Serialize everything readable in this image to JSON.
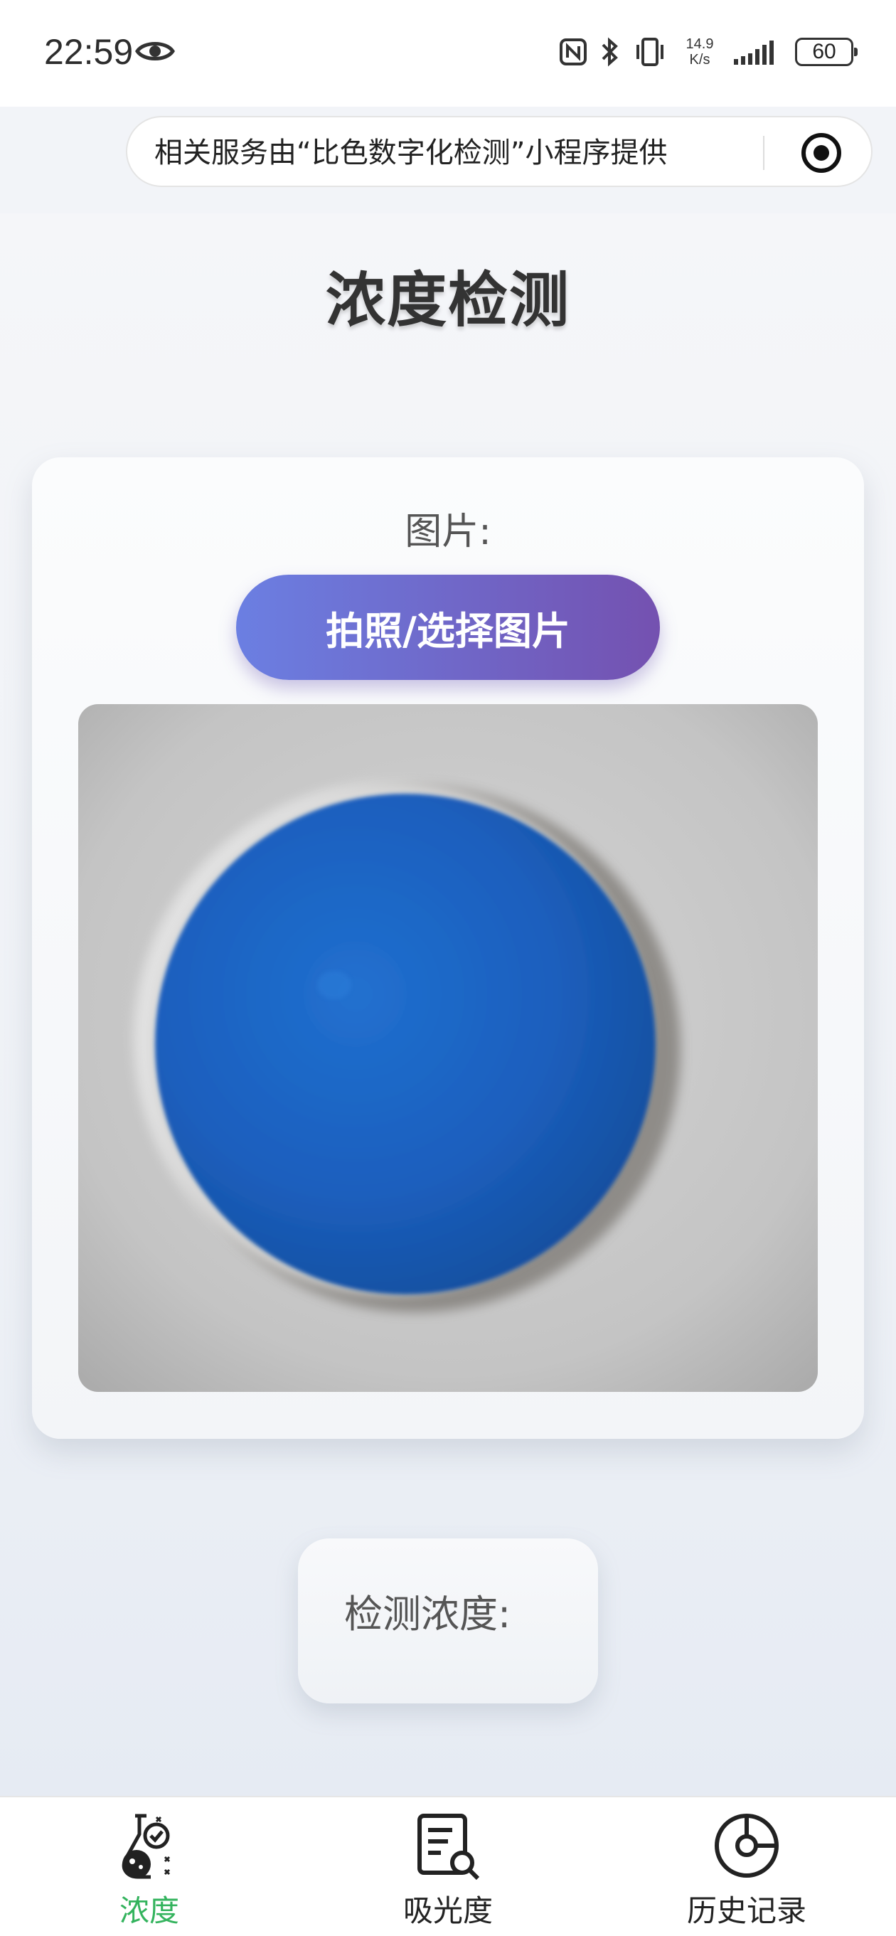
{
  "status_bar": {
    "time": "22:59",
    "net_speed_value": "14.9",
    "net_speed_unit": "K/s",
    "battery": "60"
  },
  "notice": {
    "text": "相关服务由“比色数字化检测”小程序提供"
  },
  "page": {
    "title": "浓度检测"
  },
  "image_section": {
    "label": "图片:",
    "pick_button_label": "拍照/选择图片"
  },
  "result": {
    "label": "检测浓度:"
  },
  "tabbar": {
    "items": [
      {
        "label": "浓度",
        "icon": "flask-icon",
        "active": true
      },
      {
        "label": "吸光度",
        "icon": "document-search-icon",
        "active": false
      },
      {
        "label": "历史记录",
        "icon": "history-icon",
        "active": false
      }
    ]
  },
  "colors": {
    "accent_green": "#33b35d",
    "button_gradient_start": "#6b7fe2",
    "button_gradient_end": "#7451b0",
    "sample_blue": "#1e63c4"
  }
}
